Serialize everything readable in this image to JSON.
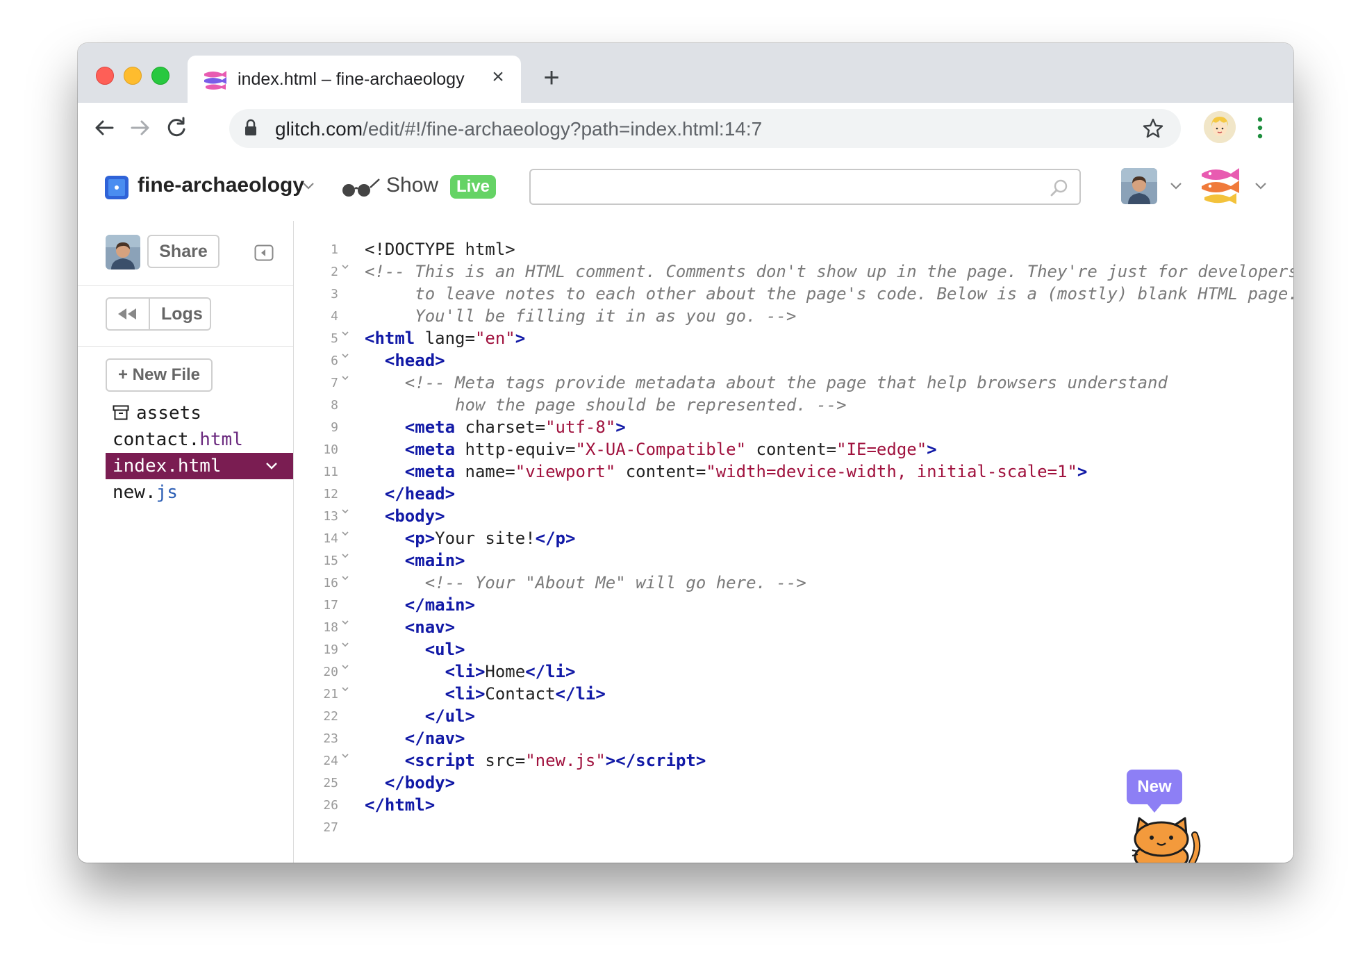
{
  "browser": {
    "tab": {
      "title": "index.html – fine-archaeology",
      "close_label": "×"
    },
    "new_tab_label": "+",
    "url": {
      "host": "glitch.com",
      "path": "/edit/#!/fine-archaeology?path=index.html:14:7"
    }
  },
  "header": {
    "project_name": "fine-archaeology",
    "show_label": "Show",
    "live_label": "Live",
    "search_placeholder": ""
  },
  "sidebar": {
    "share_label": "Share",
    "logs_label": "Logs",
    "new_file_label": "+ New File",
    "files": [
      {
        "name": "assets",
        "ext": ""
      },
      {
        "name": "contact.",
        "ext": "html"
      },
      {
        "name": "index.",
        "ext": "html"
      },
      {
        "name": "new.",
        "ext": "js"
      }
    ]
  },
  "editor": {
    "line_numbers": [
      "1",
      "2",
      "3",
      "4",
      "5",
      "6",
      "7",
      "8",
      "9",
      "10",
      "11",
      "12",
      "13",
      "14",
      "15",
      "16",
      "17",
      "18",
      "19",
      "20",
      "21",
      "22",
      "23",
      "24",
      "25",
      "26",
      "27"
    ]
  },
  "widget": {
    "new_label": "New"
  },
  "colors": {
    "active_file_bg": "#7a1d52",
    "tag": "#1119a6",
    "string": "#a0123e",
    "comment": "#7a7a7a",
    "live": "#65d365"
  }
}
